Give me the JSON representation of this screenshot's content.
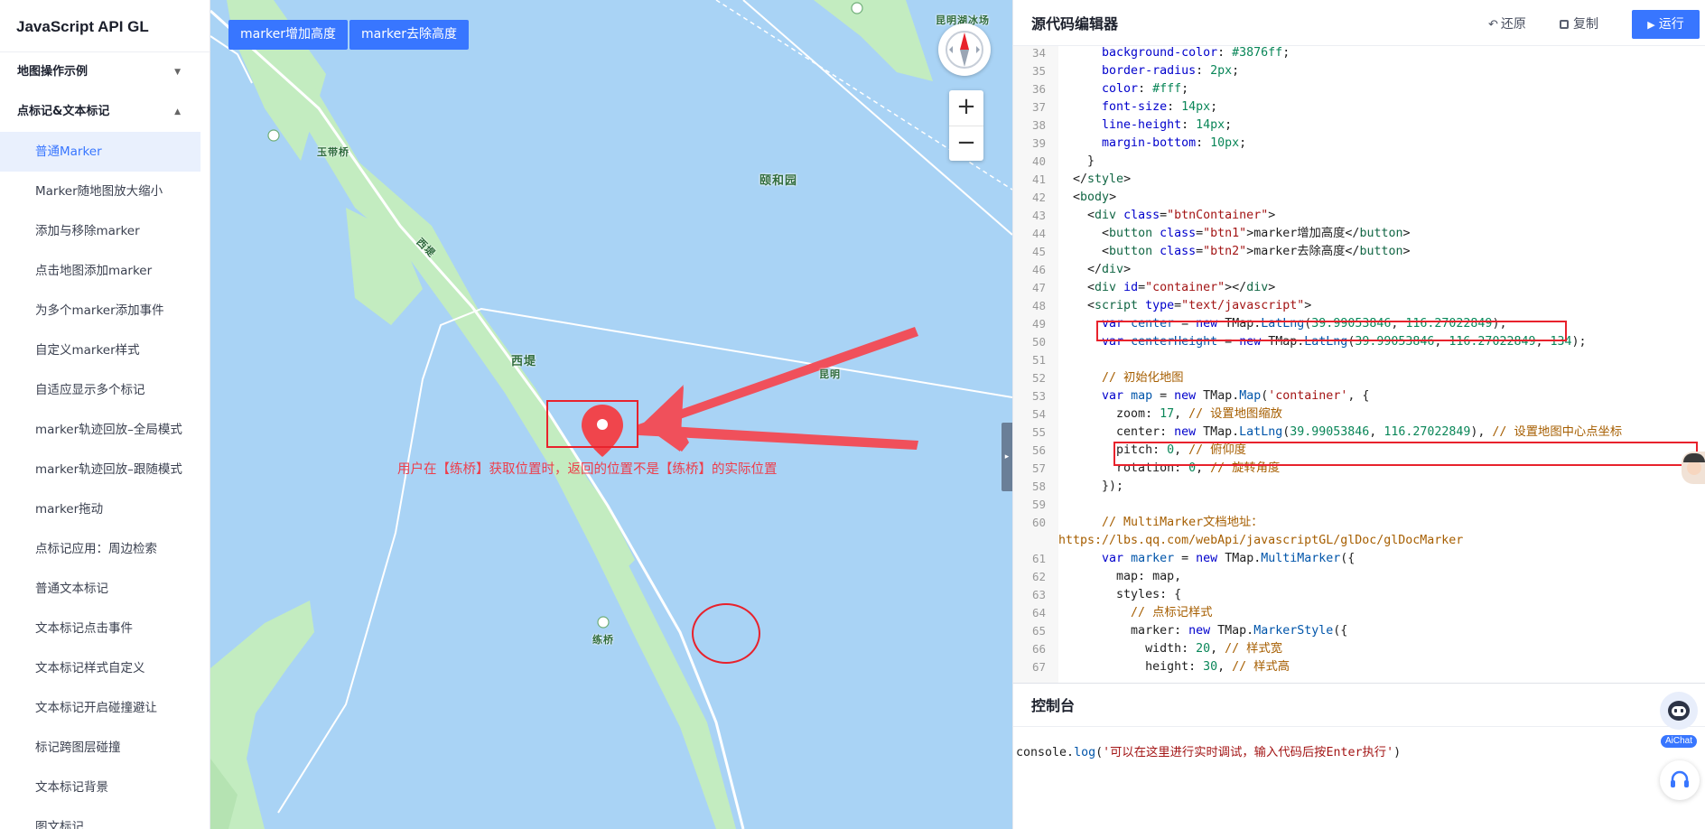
{
  "sidebar": {
    "app_title": "JavaScript API GL",
    "groups": [
      {
        "label": "地图操作示例",
        "expanded": false
      },
      {
        "label": "点标记&文本标记",
        "expanded": true
      }
    ],
    "items": [
      {
        "label": "普通Marker",
        "active": true
      },
      {
        "label": "Marker随地图放大缩小"
      },
      {
        "label": "添加与移除marker"
      },
      {
        "label": "点击地图添加marker"
      },
      {
        "label": "为多个marker添加事件"
      },
      {
        "label": "自定义marker样式"
      },
      {
        "label": "自适应显示多个标记"
      },
      {
        "label": "marker轨迹回放–全局模式"
      },
      {
        "label": "marker轨迹回放–跟随模式"
      },
      {
        "label": "marker拖动"
      },
      {
        "label": "点标记应用：周边检索"
      },
      {
        "label": "普通文本标记"
      },
      {
        "label": "文本标记点击事件"
      },
      {
        "label": "文本标记样式自定义"
      },
      {
        "label": "文本标记开启碰撞避让"
      },
      {
        "label": "标记跨图层碰撞"
      },
      {
        "label": "文本标记背景"
      },
      {
        "label": "图文标记"
      }
    ]
  },
  "map": {
    "buttons": {
      "add_height": "marker增加高度",
      "remove_height": "marker去除高度"
    },
    "labels": {
      "yudaiqiao": "玉带桥",
      "yiheyuan": "颐和园",
      "xidi_road": "西堤",
      "xidi": "西堤",
      "lianqiao": "练桥",
      "kunming_top": "昆明湖冰场",
      "kunming_mid": "昆明"
    },
    "annotation": "用户在【练桥】获取位置时，返回的位置不是【练桥】的实际位置",
    "zoom_in": "+",
    "zoom_out": "−",
    "colors": {
      "water": "#a9d3f5",
      "land": "#c3ecc0",
      "annotation": "#e8222c",
      "marker": "#f0454c"
    }
  },
  "editor": {
    "title": "源代码编辑器",
    "restore_label": "还原",
    "copy_label": "复制",
    "run_label": "运行",
    "lines": [
      {
        "n": "34",
        "parts": [
          [
            "prop",
            "      background-color"
          ],
          [
            "",
            ": "
          ],
          [
            "num",
            "#3876ff"
          ],
          [
            "",
            ";"
          ]
        ]
      },
      {
        "n": "35",
        "parts": [
          [
            "prop",
            "      border-radius"
          ],
          [
            "",
            ": "
          ],
          [
            "num",
            "2px"
          ],
          [
            "",
            ";"
          ]
        ]
      },
      {
        "n": "36",
        "parts": [
          [
            "prop",
            "      color"
          ],
          [
            "",
            ": "
          ],
          [
            "num",
            "#fff"
          ],
          [
            "",
            ";"
          ]
        ]
      },
      {
        "n": "37",
        "parts": [
          [
            "prop",
            "      font-size"
          ],
          [
            "",
            ": "
          ],
          [
            "num",
            "14px"
          ],
          [
            "",
            ";"
          ]
        ]
      },
      {
        "n": "38",
        "parts": [
          [
            "prop",
            "      line-height"
          ],
          [
            "",
            ": "
          ],
          [
            "num",
            "14px"
          ],
          [
            "",
            ";"
          ]
        ]
      },
      {
        "n": "39",
        "parts": [
          [
            "prop",
            "      margin-bottom"
          ],
          [
            "",
            ": "
          ],
          [
            "num",
            "10px"
          ],
          [
            "",
            ";"
          ]
        ]
      },
      {
        "n": "40",
        "parts": [
          [
            "",
            "    }"
          ]
        ]
      },
      {
        "n": "41",
        "parts": [
          [
            "",
            "  </"
          ],
          [
            "tag",
            "style"
          ],
          [
            "",
            ">"
          ]
        ]
      },
      {
        "n": "42",
        "parts": [
          [
            "",
            "  <"
          ],
          [
            "tag",
            "body"
          ],
          [
            "",
            ">"
          ]
        ]
      },
      {
        "n": "43",
        "parts": [
          [
            "",
            "    <"
          ],
          [
            "tag",
            "div"
          ],
          [
            "",
            " "
          ],
          [
            "attr",
            "class"
          ],
          [
            "",
            "="
          ],
          [
            "str",
            "\"btnContainer\""
          ],
          [
            "",
            ">"
          ]
        ]
      },
      {
        "n": "44",
        "parts": [
          [
            "",
            "      <"
          ],
          [
            "tag",
            "button"
          ],
          [
            "",
            " "
          ],
          [
            "attr",
            "class"
          ],
          [
            "",
            "="
          ],
          [
            "str",
            "\"btn1\""
          ],
          [
            "",
            ">marker增加高度</"
          ],
          [
            "tag",
            "button"
          ],
          [
            "",
            ">"
          ]
        ]
      },
      {
        "n": "45",
        "parts": [
          [
            "",
            "      <"
          ],
          [
            "tag",
            "button"
          ],
          [
            "",
            " "
          ],
          [
            "attr",
            "class"
          ],
          [
            "",
            "="
          ],
          [
            "str",
            "\"btn2\""
          ],
          [
            "",
            ">marker去除高度</"
          ],
          [
            "tag",
            "button"
          ],
          [
            "",
            ">"
          ]
        ]
      },
      {
        "n": "46",
        "parts": [
          [
            "",
            "    </"
          ],
          [
            "tag",
            "div"
          ],
          [
            "",
            ">"
          ]
        ]
      },
      {
        "n": "47",
        "parts": [
          [
            "",
            "    <"
          ],
          [
            "tag",
            "div"
          ],
          [
            "",
            " "
          ],
          [
            "attr",
            "id"
          ],
          [
            "",
            "="
          ],
          [
            "str",
            "\"container\""
          ],
          [
            "",
            "></"
          ],
          [
            "tag",
            "div"
          ],
          [
            "",
            ">"
          ]
        ]
      },
      {
        "n": "48",
        "parts": [
          [
            "",
            "    <"
          ],
          [
            "tag",
            "script"
          ],
          [
            "",
            " "
          ],
          [
            "attr",
            "type"
          ],
          [
            "",
            "="
          ],
          [
            "str",
            "\"text/javascript\""
          ],
          [
            "",
            ">"
          ]
        ]
      },
      {
        "n": "49",
        "parts": [
          [
            "kw",
            "      var"
          ],
          [
            "",
            " "
          ],
          [
            "fn",
            "center"
          ],
          [
            "",
            " = "
          ],
          [
            "kw",
            "new"
          ],
          [
            "",
            " TMap."
          ],
          [
            "fn",
            "LatLng"
          ],
          [
            "",
            "("
          ],
          [
            "num",
            "39.99053846"
          ],
          [
            "",
            ", "
          ],
          [
            "num",
            "116.27022849"
          ],
          [
            "",
            ");"
          ]
        ]
      },
      {
        "n": "50",
        "parts": [
          [
            "kw",
            "      var"
          ],
          [
            "",
            " "
          ],
          [
            "fn",
            "centerHeight"
          ],
          [
            "",
            " = "
          ],
          [
            "kw",
            "new"
          ],
          [
            "",
            " TMap."
          ],
          [
            "fn",
            "LatLng"
          ],
          [
            "",
            "("
          ],
          [
            "num",
            "39.99053846"
          ],
          [
            "",
            ", "
          ],
          [
            "num",
            "116.27022849"
          ],
          [
            "",
            ", "
          ],
          [
            "num",
            "134"
          ],
          [
            "",
            ");"
          ]
        ]
      },
      {
        "n": "51",
        "parts": [
          [
            "",
            ""
          ]
        ]
      },
      {
        "n": "52",
        "parts": [
          [
            "cm",
            "      // 初始化地图"
          ]
        ]
      },
      {
        "n": "53",
        "parts": [
          [
            "kw",
            "      var"
          ],
          [
            "",
            " "
          ],
          [
            "fn",
            "map"
          ],
          [
            "",
            " = "
          ],
          [
            "kw",
            "new"
          ],
          [
            "",
            " TMap."
          ],
          [
            "fn",
            "Map"
          ],
          [
            "",
            "("
          ],
          [
            "str",
            "'container'"
          ],
          [
            "",
            ", {"
          ]
        ]
      },
      {
        "n": "54",
        "parts": [
          [
            "",
            "        zoom: "
          ],
          [
            "num",
            "17"
          ],
          [
            "",
            ", "
          ],
          [
            "cm",
            "// 设置地图缩放"
          ]
        ]
      },
      {
        "n": "55",
        "parts": [
          [
            "",
            "        center: "
          ],
          [
            "kw",
            "new"
          ],
          [
            "",
            " TMap."
          ],
          [
            "fn",
            "LatLng"
          ],
          [
            "",
            "("
          ],
          [
            "num",
            "39.99053846"
          ],
          [
            "",
            ", "
          ],
          [
            "num",
            "116.27022849"
          ],
          [
            "",
            "), "
          ],
          [
            "cm",
            "// 设置地图中心点坐标"
          ]
        ]
      },
      {
        "n": "56",
        "parts": [
          [
            "",
            "        pitch: "
          ],
          [
            "num",
            "0"
          ],
          [
            "",
            ", "
          ],
          [
            "cm",
            "// 俯仰度"
          ]
        ]
      },
      {
        "n": "57",
        "parts": [
          [
            "",
            "        rotation: "
          ],
          [
            "num",
            "0"
          ],
          [
            "",
            ", "
          ],
          [
            "cm",
            "// 旋转角度"
          ]
        ]
      },
      {
        "n": "58",
        "parts": [
          [
            "",
            "      });"
          ]
        ]
      },
      {
        "n": "59",
        "parts": [
          [
            "",
            ""
          ]
        ]
      },
      {
        "n": "60",
        "parts": [
          [
            "cm",
            "      // MultiMarker文档地址："
          ]
        ]
      },
      {
        "n": "",
        "parts": [
          [
            "cm",
            "https://lbs.qq.com/webApi/javascriptGL/glDoc/glDocMarker"
          ]
        ]
      },
      {
        "n": "61",
        "parts": [
          [
            "kw",
            "      var"
          ],
          [
            "",
            " "
          ],
          [
            "fn",
            "marker"
          ],
          [
            "",
            " = "
          ],
          [
            "kw",
            "new"
          ],
          [
            "",
            " TMap."
          ],
          [
            "fn",
            "MultiMarker"
          ],
          [
            "",
            "({"
          ]
        ]
      },
      {
        "n": "62",
        "parts": [
          [
            "",
            "        map: map,"
          ]
        ]
      },
      {
        "n": "63",
        "parts": [
          [
            "",
            "        styles: {"
          ]
        ]
      },
      {
        "n": "64",
        "parts": [
          [
            "cm",
            "          // 点标记样式"
          ]
        ]
      },
      {
        "n": "65",
        "parts": [
          [
            "",
            "          marker: "
          ],
          [
            "kw",
            "new"
          ],
          [
            "",
            " TMap."
          ],
          [
            "fn",
            "MarkerStyle"
          ],
          [
            "",
            "({"
          ]
        ]
      },
      {
        "n": "66",
        "parts": [
          [
            "",
            "            width: "
          ],
          [
            "num",
            "20"
          ],
          [
            "",
            ", "
          ],
          [
            "cm",
            "// 样式宽"
          ]
        ]
      },
      {
        "n": "67",
        "parts": [
          [
            "",
            "            height: "
          ],
          [
            "num",
            "30"
          ],
          [
            "",
            ", "
          ],
          [
            "cm",
            "// 样式高"
          ]
        ]
      }
    ]
  },
  "console": {
    "title": "控制台",
    "line_obj": "console",
    "line_dot": ".",
    "line_fn": "log",
    "line_open": "(",
    "line_str": "'可以在这里进行实时调试，输入代码后按Enter执行'",
    "line_close": ")"
  },
  "aichat": {
    "label": "AiChat"
  }
}
